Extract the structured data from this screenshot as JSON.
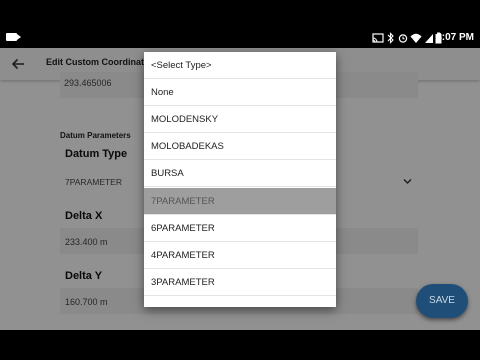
{
  "status_bar": {
    "time": "4:07 PM",
    "icons": [
      "camera-icon",
      "cast-icon",
      "bluetooth-icon",
      "alarm-icon",
      "wifi-icon",
      "signal-icon",
      "battery-icon"
    ]
  },
  "toolbar": {
    "title": "Edit Custom Coordinate",
    "back_icon": "arrow-left-icon"
  },
  "form": {
    "top_value": "293.465006",
    "section_label": "Datum Parameters",
    "datum_type_heading": "Datum Type",
    "datum_type_value": "7PARAMETER",
    "delta_x_heading": "Delta X",
    "delta_x_value": "233.400 m",
    "delta_y_heading": "Delta Y",
    "delta_y_value": "160.700 m",
    "save_label": "SAVE"
  },
  "dropdown": {
    "items": [
      "<Select Type>",
      "None",
      "MOLODENSKY",
      "MOLOBADEKAS",
      "BURSA",
      "7PARAMETER",
      "6PARAMETER",
      "4PARAMETER",
      "3PARAMETER"
    ],
    "selected": "7PARAMETER"
  },
  "colors": {
    "accent": "#1f4f78",
    "selected_row": "#9e9e9e"
  }
}
